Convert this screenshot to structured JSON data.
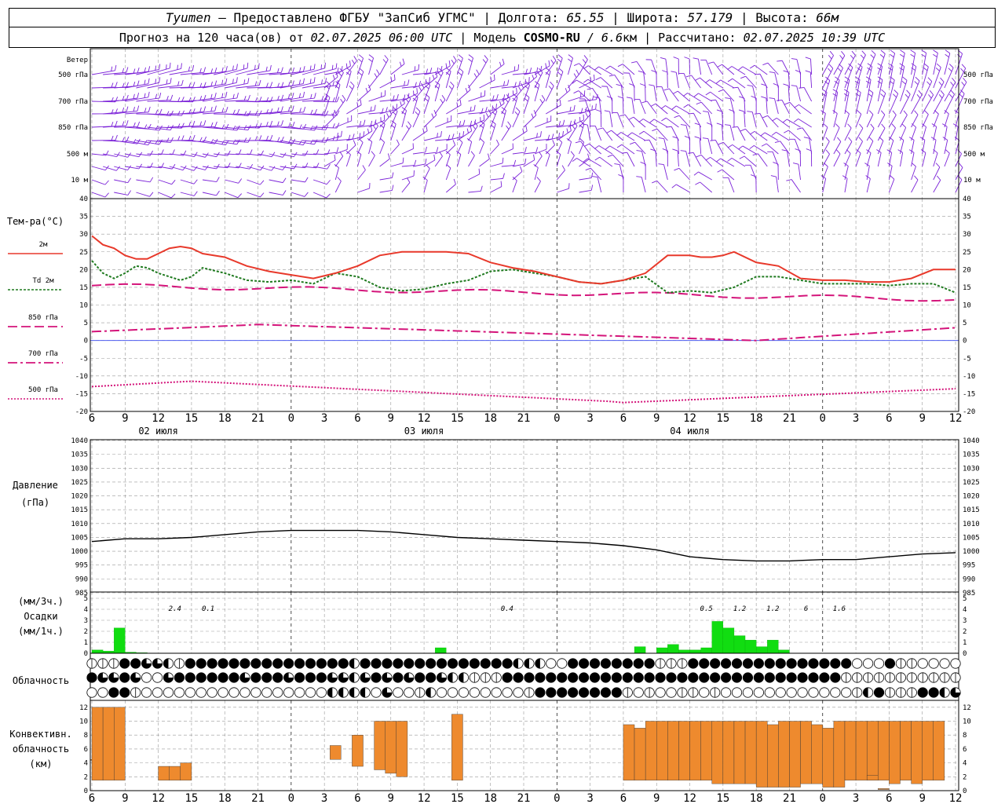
{
  "header": {
    "city": "Tyumen",
    "provider": " – Предоставлено ФГБУ \"ЗапСиб УГМС\"",
    "lon_label": "Долгота: ",
    "lon_value": "65.55",
    "lat_label": "Широта: ",
    "lat_value": "57.179",
    "alt_label": "Высота: ",
    "alt_value": "66м",
    "forecast_prefix": "Прогноз на 120 часа(ов) от ",
    "forecast_time": "02.07.2025 06:00 UTC",
    "model_prefix": "  | Модель ",
    "model_name": "COSMO-RU",
    "model_res": " / 6.6",
    "model_res_unit": "км",
    "calc_prefix": " | Рассчитано: ",
    "calc_time": "02.07.2025 10:39 UTC"
  },
  "wind_panel": {
    "title": "Ветер",
    "levels": [
      "500 гПа",
      "700 гПа",
      "850 гПа",
      "500 м",
      "10  м"
    ],
    "color": "#7b22d8"
  },
  "temp_panel": {
    "title": "Тем-ра(°C)",
    "legend": [
      {
        "label": "2м",
        "color": "#e8392b"
      },
      {
        "label": "Td  2м",
        "color": "#1f7a1f"
      },
      {
        "label": "850 гПа",
        "color": "#d4147a"
      },
      {
        "label": "700 гПа",
        "color": "#d4147a"
      },
      {
        "label": "500 гПа",
        "color": "#d4147a"
      }
    ],
    "yticks": [
      40,
      35,
      30,
      25,
      20,
      15,
      10,
      5,
      0,
      -5,
      -10,
      -15,
      -20
    ]
  },
  "time_axis": {
    "hour_labels": [
      "6",
      "9",
      "12",
      "15",
      "18",
      "21",
      "0",
      "3",
      "6",
      "9",
      "12",
      "15",
      "18",
      "21",
      "0",
      "3",
      "6",
      "9",
      "12",
      "15",
      "18",
      "21",
      "0",
      "3",
      "6",
      "9",
      "12"
    ],
    "day_labels": [
      "02 июля",
      "03 июля",
      "04 июля"
    ]
  },
  "pressure_panel": {
    "title": "Давление",
    "unit": "(гПа)",
    "yticks": [
      1040,
      1035,
      1030,
      1025,
      1020,
      1015,
      1010,
      1005,
      1000,
      995,
      990,
      985
    ]
  },
  "precip_panel": {
    "label1": "(мм/3ч.)",
    "label2": "Осадки",
    "label3": "(мм/1ч.)",
    "yticks": [
      5,
      4,
      3,
      2,
      1,
      0
    ],
    "totals": [
      {
        "hour": 7.5,
        "text": "2.4"
      },
      {
        "hour": 10.5,
        "text": "0.1"
      },
      {
        "hour": 37.5,
        "text": "0.4"
      },
      {
        "hour": 55.5,
        "text": "0.5"
      },
      {
        "hour": 58.5,
        "text": "1.2"
      },
      {
        "hour": 61.5,
        "text": "1.2"
      },
      {
        "hour": 64.5,
        "text": "6"
      },
      {
        "hour": 67.5,
        "text": "1.6"
      }
    ],
    "color": "#11dd11"
  },
  "cloud_panel": {
    "title": "Облачность"
  },
  "conv_panel": {
    "label1": "Конвективн.",
    "label2": "облачность",
    "label3": "(км)",
    "yticks": [
      12,
      10,
      8,
      6,
      4,
      2,
      0
    ],
    "color": "#ee8a2e"
  },
  "chart_data": {
    "type": "meteogram",
    "x_hours_from_start": "0..78 (start 02.07.2025 06 UTC)",
    "temperature": {
      "ylim": [
        -20,
        40
      ],
      "series": [
        {
          "name": "2м",
          "x": [
            0,
            1,
            2,
            3,
            4,
            5,
            6,
            7,
            8,
            9,
            10,
            12,
            14,
            16,
            18,
            20,
            22,
            24,
            26,
            28,
            30,
            32,
            34,
            36,
            38,
            40,
            42,
            44,
            46,
            48,
            50,
            52,
            54,
            55,
            56,
            57,
            58,
            60,
            62,
            64,
            66,
            68,
            70,
            72,
            74,
            76,
            78
          ],
          "y": [
            29.5,
            27,
            26,
            24,
            23,
            23,
            24.5,
            26,
            26.5,
            26,
            24.5,
            23.5,
            21,
            19.5,
            18.5,
            17.5,
            19,
            21,
            24,
            25,
            25,
            25,
            24.5,
            22,
            20.5,
            19.5,
            18,
            16.5,
            16,
            17,
            19,
            24,
            24,
            23.5,
            23.5,
            24,
            25,
            22,
            21,
            17.5,
            17,
            17,
            16.5,
            16.5,
            17.5,
            20,
            20,
            19.8,
            24,
            24.5,
            24.2
          ]
        },
        {
          "name": "Td  2м",
          "x": [
            0,
            1,
            2,
            3,
            4,
            5,
            6,
            7,
            8,
            9,
            10,
            12,
            14,
            16,
            18,
            20,
            22,
            24,
            26,
            28,
            30,
            32,
            34,
            36,
            38,
            40,
            42,
            44,
            46,
            48,
            50,
            52,
            54,
            56,
            58,
            60,
            62,
            64,
            66,
            68,
            70,
            72,
            74,
            76,
            78
          ],
          "y": [
            22.5,
            19,
            17.5,
            19,
            21,
            20.5,
            19,
            18,
            17,
            18,
            20.5,
            19,
            17,
            16.5,
            17,
            16,
            19,
            18,
            15,
            14,
            14.5,
            16,
            17,
            19.5,
            20,
            19,
            18,
            16.5,
            16,
            17,
            18,
            13.5,
            14,
            13.5,
            15,
            18,
            18,
            17,
            16,
            16,
            16,
            15.5,
            16,
            16,
            13.5,
            13,
            13.5
          ]
        },
        {
          "name": "850 гПа",
          "y_approx": "15.5 → 11.5",
          "range": [
            9,
            16
          ]
        },
        {
          "name": "700 гПа",
          "y_approx": "2.5 → 4.5 → 0 → 3.5",
          "range": [
            0,
            5
          ]
        },
        {
          "name": "500 гПа",
          "y_approx": "-13 → -11.5 → -17.5 → -13.5",
          "range": [
            -18,
            -11
          ]
        }
      ]
    },
    "pressure": {
      "ylim": [
        985,
        1040
      ],
      "x": [
        0,
        3,
        6,
        9,
        12,
        15,
        18,
        21,
        24,
        27,
        30,
        33,
        36,
        39,
        42,
        45,
        48,
        51,
        54,
        57,
        60,
        63,
        66,
        69,
        72,
        75,
        78
      ],
      "y": [
        1003.5,
        1004.5,
        1004.5,
        1005,
        1006,
        1007,
        1007.5,
        1007.5,
        1007.5,
        1007,
        1006,
        1005,
        1004.5,
        1004,
        1003.5,
        1003,
        1002,
        1000.5,
        998,
        997,
        996.5,
        996.5,
        997,
        997,
        998,
        999,
        999.5
      ]
    },
    "precip_1h": {
      "ylim": [
        0,
        5
      ],
      "x": [
        0,
        1,
        2,
        3,
        4,
        31,
        49,
        51,
        52,
        53,
        54,
        55,
        56,
        57,
        58,
        59,
        60,
        61,
        62,
        63
      ],
      "y": [
        0.3,
        0.2,
        2.3,
        0.1,
        0.05,
        0.5,
        0.6,
        0.5,
        0.8,
        0.3,
        0.3,
        0.5,
        2.9,
        2.3,
        1.6,
        1.2,
        0.6,
        1.2,
        0.3,
        0
      ]
    },
    "convective_cloud_km": {
      "ylim": [
        0,
        13
      ],
      "bars": [
        {
          "x0": -1,
          "x1": 0,
          "bottom": 4.5,
          "top": 4.5
        },
        {
          "x0": 0,
          "x1": 1,
          "bottom": 1.5,
          "top": 12
        },
        {
          "x0": 1,
          "x1": 2,
          "bottom": 1.5,
          "top": 12
        },
        {
          "x0": 2,
          "x1": 3,
          "bottom": 1.5,
          "top": 12
        },
        {
          "x0": 6,
          "x1": 7,
          "bottom": 1.5,
          "top": 3.5
        },
        {
          "x0": 7,
          "x1": 8,
          "bottom": 1.5,
          "top": 3.5
        },
        {
          "x0": 8,
          "x1": 9,
          "bottom": 1.5,
          "top": 4
        },
        {
          "x0": 21.5,
          "x1": 22.5,
          "bottom": 4.5,
          "top": 6.5
        },
        {
          "x0": 23.5,
          "x1": 24.5,
          "bottom": 3.5,
          "top": 8
        },
        {
          "x0": 25.5,
          "x1": 26.5,
          "bottom": 3,
          "top": 10
        },
        {
          "x0": 26.5,
          "x1": 27.5,
          "bottom": 2.5,
          "top": 10
        },
        {
          "x0": 27.5,
          "x1": 28.5,
          "bottom": 2,
          "top": 10
        },
        {
          "x0": 32.5,
          "x1": 33.5,
          "bottom": 1.5,
          "top": 11
        },
        {
          "x0": 48,
          "x1": 49,
          "bottom": 1.5,
          "top": 9.5
        },
        {
          "x0": 49,
          "x1": 50,
          "bottom": 1.5,
          "top": 9
        },
        {
          "x0": 50,
          "x1": 51,
          "bottom": 1.5,
          "top": 10
        },
        {
          "x0": 51,
          "x1": 52,
          "bottom": 1.5,
          "top": 10
        },
        {
          "x0": 52,
          "x1": 53,
          "bottom": 1.5,
          "top": 10
        },
        {
          "x0": 53,
          "x1": 54,
          "bottom": 1.5,
          "top": 10
        },
        {
          "x0": 54,
          "x1": 55,
          "bottom": 1.5,
          "top": 10
        },
        {
          "x0": 55,
          "x1": 56,
          "bottom": 1.5,
          "top": 10
        },
        {
          "x0": 56,
          "x1": 57,
          "bottom": 1,
          "top": 10
        },
        {
          "x0": 57,
          "x1": 58,
          "bottom": 1,
          "top": 10
        },
        {
          "x0": 58,
          "x1": 59,
          "bottom": 1,
          "top": 10
        },
        {
          "x0": 59,
          "x1": 60,
          "bottom": 1,
          "top": 10
        },
        {
          "x0": 60,
          "x1": 61,
          "bottom": 0.5,
          "top": 10
        },
        {
          "x0": 61,
          "x1": 62,
          "bottom": 0.5,
          "top": 9.5
        },
        {
          "x0": 62,
          "x1": 63,
          "bottom": 0.5,
          "top": 10
        },
        {
          "x0": 63,
          "x1": 64,
          "bottom": 0.5,
          "top": 10
        },
        {
          "x0": 64,
          "x1": 65,
          "bottom": 1,
          "top": 10
        },
        {
          "x0": 65,
          "x1": 66,
          "bottom": 1,
          "top": 9.5
        },
        {
          "x0": 66,
          "x1": 67,
          "bottom": 0.5,
          "top": 9
        },
        {
          "x0": 67,
          "x1": 68,
          "bottom": 0.5,
          "top": 10
        },
        {
          "x0": 68,
          "x1": 69,
          "bottom": 1.5,
          "top": 10
        },
        {
          "x0": 69,
          "x1": 70,
          "bottom": 1.5,
          "top": 10
        },
        {
          "x0": 70,
          "x1": 71,
          "bottom": 1.5,
          "top": 10
        },
        {
          "x0": 71,
          "x1": 72,
          "bottom": 1.5,
          "top": 10
        },
        {
          "x0": 72,
          "x1": 73,
          "bottom": 1,
          "top": 10
        },
        {
          "x0": 73,
          "x1": 74,
          "bottom": 1.5,
          "top": 10
        },
        {
          "x0": 74,
          "x1": 75,
          "bottom": 1,
          "top": 10
        },
        {
          "x0": 75,
          "x1": 76,
          "bottom": 1.5,
          "top": 10
        },
        {
          "x0": 76,
          "x1": 77,
          "bottom": 1.5,
          "top": 10
        },
        {
          "x0": 70,
          "x1": 71,
          "bottom": 1.5,
          "top": 2.2
        },
        {
          "x0": 71,
          "x1": 72,
          "bottom": 0.2,
          "top": 0.3
        }
      ]
    },
    "cloud_rows": {
      "fractions_coded": "0=empty,1=quarter,2=half,3=three-quarter,4=full",
      "row1": [
        1,
        1,
        1,
        4,
        4,
        3,
        3,
        2,
        1,
        4,
        4,
        4,
        4,
        4,
        4,
        4,
        4,
        4,
        4,
        4,
        4,
        4,
        4,
        4,
        2,
        4,
        4,
        4,
        4,
        4,
        4,
        4,
        4,
        4,
        4,
        4,
        4,
        4,
        4,
        2,
        2,
        2,
        0,
        0,
        4,
        4,
        4,
        4,
        4,
        4,
        4,
        4,
        1,
        1,
        1,
        4,
        4,
        4,
        4,
        4,
        4,
        4,
        4,
        4,
        4,
        4,
        4,
        4,
        4,
        4,
        0,
        0,
        0,
        4,
        1,
        1,
        0,
        0,
        0,
        0,
        0,
        0
      ],
      "row2": [
        4,
        3,
        3,
        4,
        3,
        0,
        0,
        3,
        4,
        4,
        4,
        4,
        4,
        4,
        3,
        4,
        4,
        4,
        3,
        4,
        4,
        4,
        3,
        3,
        2,
        3,
        4,
        3,
        4,
        3,
        4,
        4,
        3,
        2,
        2,
        1,
        1,
        1,
        4,
        4,
        4,
        4,
        4,
        4,
        4,
        4,
        4,
        4,
        4,
        4,
        4,
        4,
        4,
        4,
        4,
        4,
        4,
        4,
        4,
        4,
        4,
        4,
        4,
        4,
        4,
        4,
        4,
        4,
        4,
        1,
        1,
        1,
        1,
        1,
        1,
        1,
        1,
        1,
        1,
        1,
        1,
        1
      ],
      "row3": [
        0,
        0,
        4,
        4,
        1,
        0,
        0,
        0,
        0,
        0,
        0,
        0,
        0,
        0,
        0,
        0,
        0,
        0,
        0,
        0,
        0,
        0,
        2,
        2,
        2,
        2,
        0,
        3,
        0,
        0,
        1,
        2,
        0,
        0,
        0,
        0,
        0,
        0,
        0,
        0,
        1,
        4,
        4,
        4,
        4,
        4,
        4,
        4,
        4,
        1,
        0,
        1,
        0,
        0,
        1,
        1,
        0,
        1,
        0,
        0,
        0,
        0,
        0,
        0,
        0,
        0,
        0,
        0,
        0,
        0,
        1,
        2,
        4,
        1,
        1,
        1,
        4,
        4,
        2,
        3,
        4,
        1,
        4,
        2,
        1
      ]
    }
  }
}
